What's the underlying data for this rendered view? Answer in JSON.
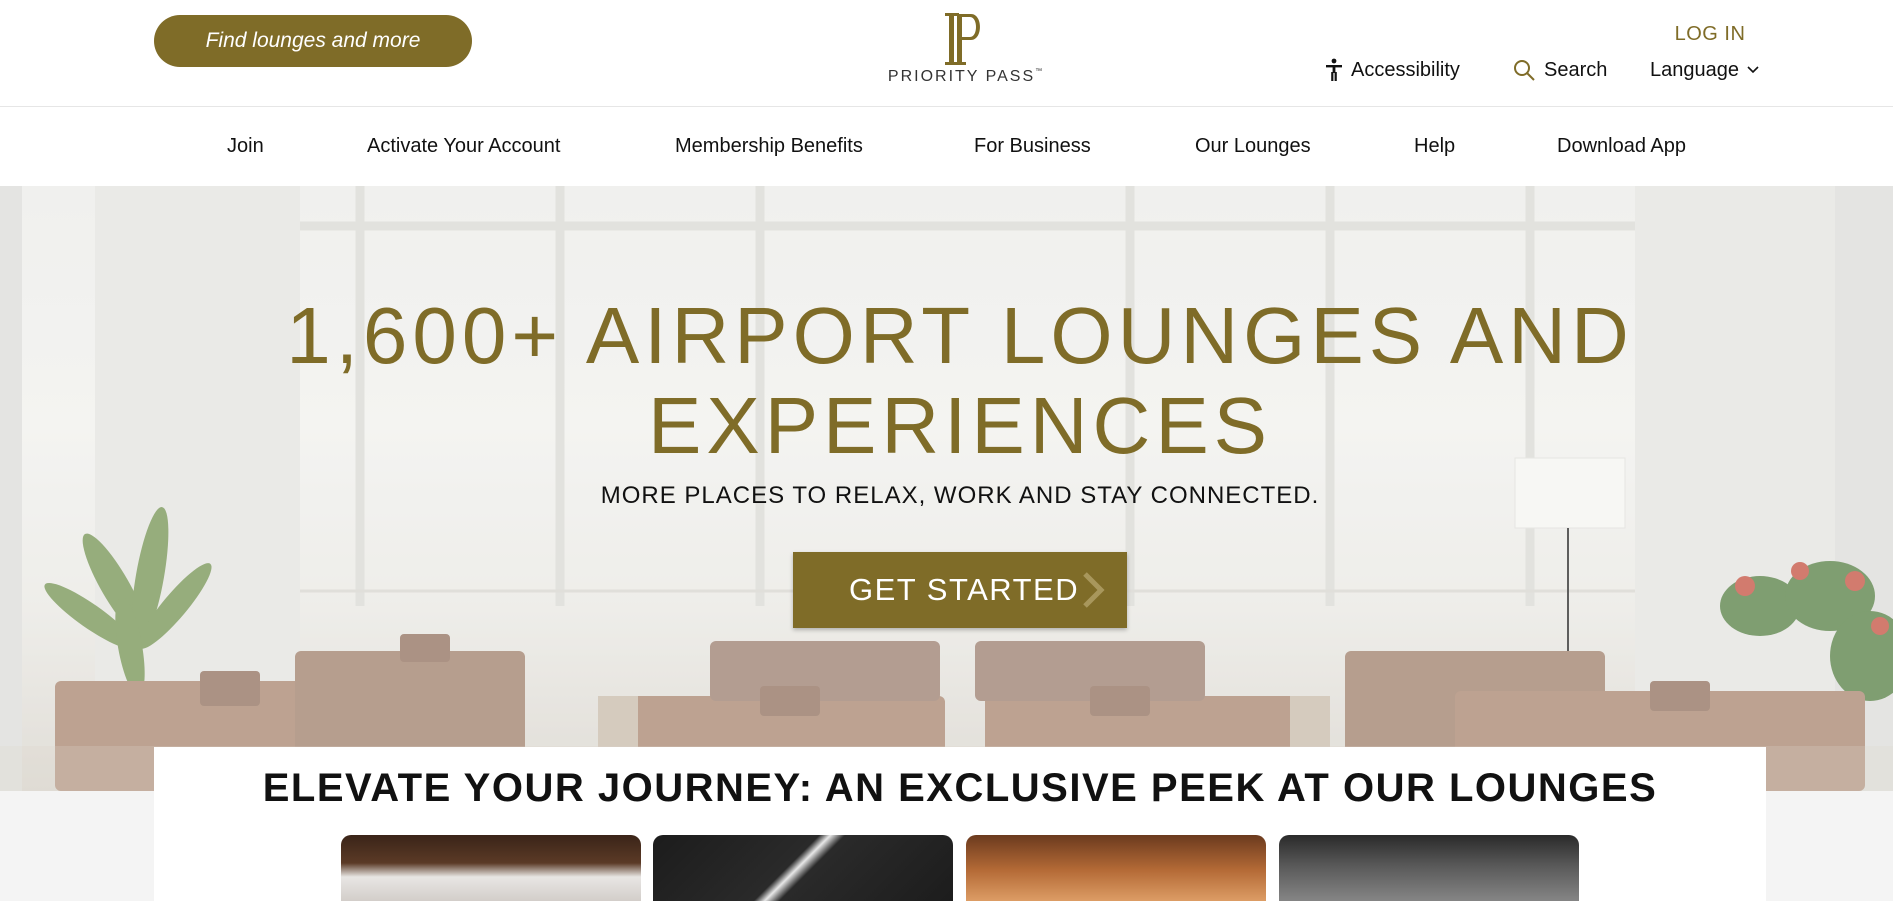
{
  "header": {
    "find_button": "Find lounges and more",
    "logo_text": "PRIORITY PASS",
    "logo_tm": "™",
    "login": "LOG IN",
    "accessibility": "Accessibility",
    "search": "Search",
    "language": "Language"
  },
  "nav": {
    "items": [
      "Join",
      "Activate Your Account",
      "Membership Benefits",
      "For Business",
      "Our Lounges",
      "Help",
      "Download App"
    ]
  },
  "hero": {
    "title_line1": "1,600+ AIRPORT LOUNGES AND",
    "title_line2": "EXPERIENCES",
    "subtitle": "MORE PLACES TO RELAX, WORK AND STAY CONNECTED.",
    "cta": "GET STARTED"
  },
  "lounges": {
    "title": "ELEVATE YOUR JOURNEY: AN EXCLUSIVE PEEK AT OUR LOUNGES"
  },
  "colors": {
    "brand_gold": "#7f6c28",
    "text": "#111111",
    "background": "#ffffff"
  },
  "icons": [
    "accessibility-icon",
    "search-icon",
    "chevron-down-icon",
    "chevron-right-icon",
    "priority-pass-logo"
  ]
}
